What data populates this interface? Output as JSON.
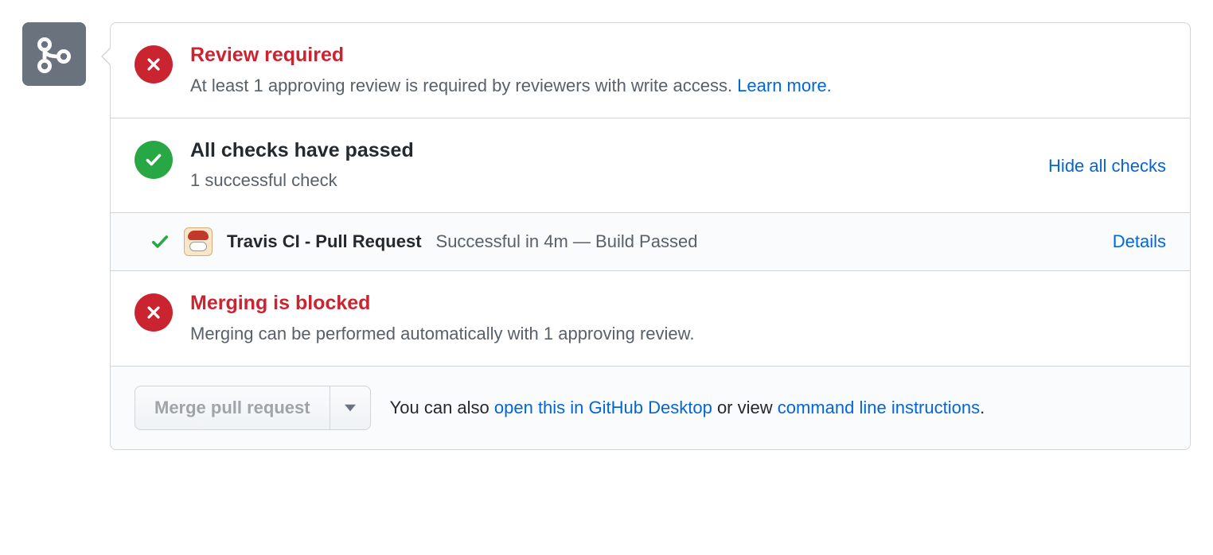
{
  "review": {
    "title": "Review required",
    "desc": "At least 1 approving review is required by reviewers with write access. ",
    "learn_more": "Learn more."
  },
  "checks": {
    "title": "All checks have passed",
    "desc": "1 successful check",
    "toggle_label": "Hide all checks",
    "items": [
      {
        "name": "Travis CI - Pull Request",
        "status": "Successful in 4m — Build Passed",
        "details_label": "Details"
      }
    ]
  },
  "blocked": {
    "title": "Merging is blocked",
    "desc": "Merging can be performed automatically with 1 approving review."
  },
  "footer": {
    "merge_button": "Merge pull request",
    "text_prefix": "You can also ",
    "desktop_link": "open this in GitHub Desktop",
    "text_middle": " or view ",
    "cli_link": "command line instructions",
    "text_suffix": "."
  }
}
